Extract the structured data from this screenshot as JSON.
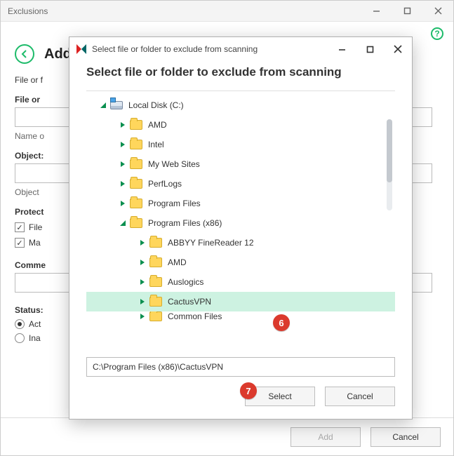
{
  "bg": {
    "window_title": "Exclusions",
    "page_title_prefix": "Add",
    "file_or_folder": "File or f",
    "file_or_label": "File or",
    "name_hint": "Name o",
    "object_label": "Object:",
    "object_hint": "Object",
    "protect_label": "Protect",
    "checkbox_file": "File",
    "checkbox_ma": "Ma",
    "comments_label": "Comme",
    "status_label": "Status:",
    "radio_act": "Act",
    "radio_ina": "Ina",
    "add_btn": "Add",
    "cancel_btn": "Cancel"
  },
  "dlg": {
    "title": "Select file or folder to exclude from scanning",
    "heading": "Select file or folder to exclude from scanning",
    "path_value": "C:\\Program Files (x86)\\CactusVPN",
    "select_btn": "Select",
    "cancel_btn": "Cancel",
    "tree": {
      "root": "Local Disk (C:)",
      "items": [
        {
          "label": "AMD",
          "depth": 1,
          "expanded": false
        },
        {
          "label": "Intel",
          "depth": 1,
          "expanded": false
        },
        {
          "label": "My Web Sites",
          "depth": 1,
          "expanded": false
        },
        {
          "label": "PerfLogs",
          "depth": 1,
          "expanded": false
        },
        {
          "label": "Program Files",
          "depth": 1,
          "expanded": false
        },
        {
          "label": "Program Files (x86)",
          "depth": 1,
          "expanded": true
        },
        {
          "label": "ABBYY FineReader 12",
          "depth": 2,
          "expanded": false
        },
        {
          "label": "AMD",
          "depth": 2,
          "expanded": false
        },
        {
          "label": "Auslogics",
          "depth": 2,
          "expanded": false
        },
        {
          "label": "CactusVPN",
          "depth": 2,
          "expanded": false,
          "selected": true
        },
        {
          "label": "Common Files",
          "depth": 2,
          "expanded": false,
          "cut": true
        }
      ]
    }
  },
  "annotations": {
    "badge6": "6",
    "badge7": "7"
  }
}
